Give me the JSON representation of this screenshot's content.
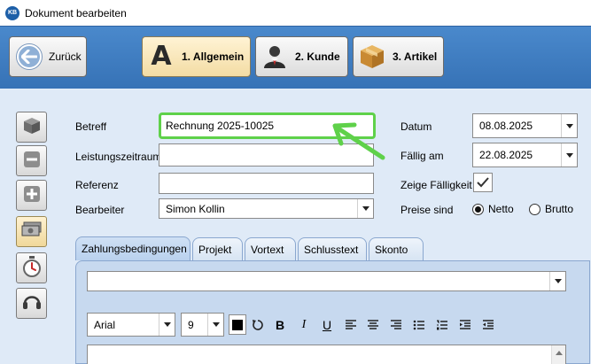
{
  "window": {
    "title": "Dokument bearbeiten",
    "logo": "KB"
  },
  "toolbar": {
    "back_label": "Zurück",
    "tabs": [
      {
        "label": "1. Allgemein",
        "icon": "letter-a-icon"
      },
      {
        "label": "2. Kunde",
        "icon": "person-icon"
      },
      {
        "label": "3. Artikel",
        "icon": "box-icon"
      }
    ],
    "allgemein_letter": "A"
  },
  "sidebar": {
    "items": [
      "box-icon",
      "minus-icon",
      "plus-icon",
      "cash-icon",
      "stopwatch-icon",
      "headset-icon"
    ]
  },
  "form": {
    "betreff_label": "Betreff",
    "betreff_value": "Rechnung 2025-10025",
    "leistungszeitraum_label": "Leistungszeitraum",
    "leistungszeitraum_value": "",
    "referenz_label": "Referenz",
    "referenz_value": "",
    "bearbeiter_label": "Bearbeiter",
    "bearbeiter_value": "Simon Kollin",
    "datum_label": "Datum",
    "datum_value": "08.08.2025",
    "faellig_label": "Fällig am",
    "faellig_value": "22.08.2025",
    "zeige_faelligkeit_label": "Zeige Fälligkeit",
    "zeige_faelligkeit_checked": true,
    "preise_label": "Preise sind",
    "netto_label": "Netto",
    "brutto_label": "Brutto",
    "preise_selected": "Netto"
  },
  "subtabs": [
    "Zahlungsbedingungen",
    "Projekt",
    "Vortext",
    "Schlusstext",
    "Skonto"
  ],
  "formatting": {
    "font": "Arial",
    "size": "9",
    "color": "#000000",
    "bold": "B",
    "italic": "I",
    "underline": "U"
  },
  "colors": {
    "accent": "#3672b6",
    "highlight": "#5fd14a",
    "panel": "#dfeaf7"
  }
}
